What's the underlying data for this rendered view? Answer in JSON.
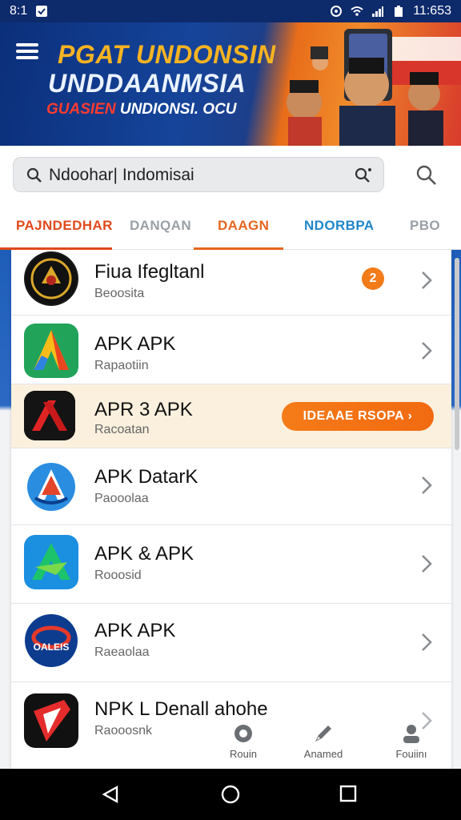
{
  "status_bar": {
    "time_left": "8:1",
    "time_right": "11:653"
  },
  "banner": {
    "title_line1": "PGAT UNDONSIN",
    "title_line2": "UNDDAANMSIA",
    "title_line3_red": "GUASIEN",
    "title_line3_rest": "UNDIONSI. OCU"
  },
  "search": {
    "value": "Ndoohar| Indomisai"
  },
  "tabs": [
    {
      "label": "PAJNDEDHAR",
      "color": "#e04a1c"
    },
    {
      "label": "DANQAN",
      "color": "#9aa0a6"
    },
    {
      "label": "DAAGN",
      "color": "#e5661e",
      "active": true
    },
    {
      "label": "NDORBPA",
      "color": "#1f86c9"
    },
    {
      "label": "PBO",
      "color": "#9aa0a6"
    }
  ],
  "apps": [
    {
      "name": "Fiua Ifegltanl",
      "sub": "Beoosita",
      "badge": "2",
      "icon": "emblem-icon"
    },
    {
      "name": "APK APK",
      "sub": "Rapaotiin",
      "icon": "green-a-icon"
    },
    {
      "name": "APR 3 APK",
      "sub": "Racoatan",
      "button": "IDEAAE RSOPA ›",
      "icon": "red-x-icon"
    },
    {
      "name": "APK DatarK",
      "sub": "Paooolaa",
      "icon": "blue-a-icon"
    },
    {
      "name": "APK & APK",
      "sub": "Rooosid",
      "icon": "green-arrow-icon"
    },
    {
      "name": "APK APK",
      "sub": "Raeaolaa",
      "icon": "oval-logo-icon"
    },
    {
      "name": "NPK L Denall ahohe",
      "sub": "Raooosnk",
      "icon": "red-shield-icon"
    }
  ],
  "oval_logo_text": "OALEIS",
  "bottom_nav": [
    {
      "label": "Rouin",
      "icon": "home-icon"
    },
    {
      "label": "Anamed",
      "icon": "pencil-icon"
    },
    {
      "label": "Fouiinı",
      "icon": "profile-icon"
    }
  ],
  "colors": {
    "primary_blue": "#0d2a6b",
    "accent_orange": "#f27b1a"
  }
}
